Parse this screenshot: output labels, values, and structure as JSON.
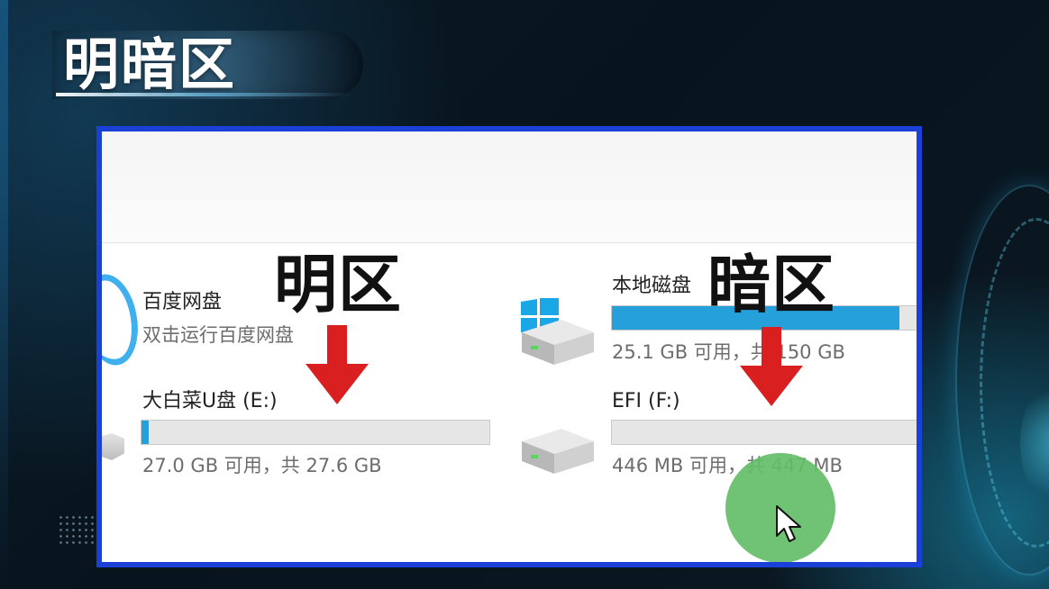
{
  "slide": {
    "title": "明暗区"
  },
  "explorer": {
    "left_label": "明区",
    "right_label": "暗区",
    "left_items": [
      {
        "name": "百度网盘",
        "description": "双击运行百度网盘",
        "icon": "baidu-netdisk-icon"
      },
      {
        "name": "大白菜U盘 (E:)",
        "free_text": "27.0 GB 可用，共 27.6 GB",
        "usage_fraction": 0.02,
        "icon": "usb-drive-icon"
      }
    ],
    "right_items": [
      {
        "name": "本地磁盘",
        "free_text": "25.1 GB 可用，共 150 GB",
        "usage_fraction": 0.83,
        "icon": "windows-drive-icon"
      },
      {
        "name": "EFI (F:)",
        "free_text": "446 MB 可用，共 447 MB",
        "usage_fraction": 0.0,
        "icon": "drive-icon"
      }
    ]
  },
  "colors": {
    "panel_border": "#1b40d8",
    "arrow_red": "#d91f1f",
    "progress_blue": "#26a0da",
    "cursor_highlight": "#64bd69"
  }
}
